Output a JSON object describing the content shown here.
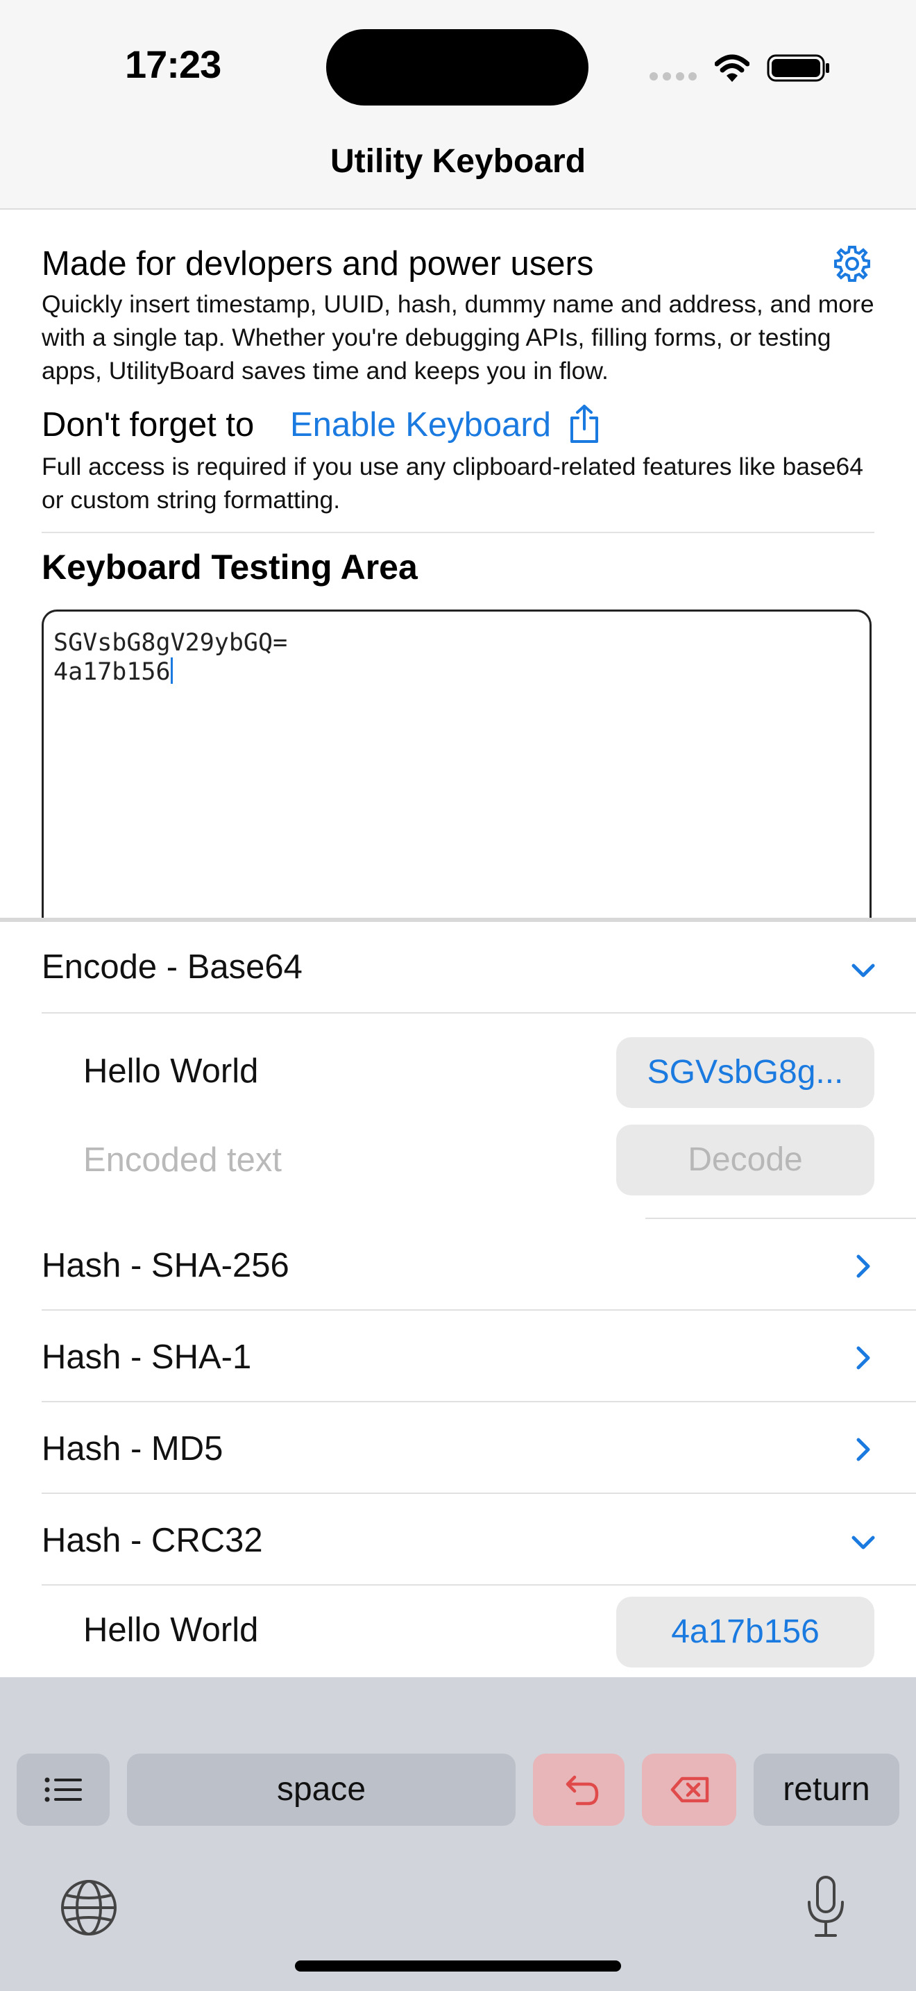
{
  "status_bar": {
    "time": "17:23"
  },
  "nav": {
    "title": "Utility Keyboard"
  },
  "intro": {
    "heading": "Made for devlopers and power users",
    "description": "Quickly insert timestamp, UUID, hash, dummy name and address, and more with a single tap. Whether you're debugging APIs, filling forms, or testing apps, UtilityBoard saves time and keeps you in flow.",
    "reminder_prefix": "Don't forget to",
    "enable_link": "Enable Keyboard",
    "access_note": "Full access is required if you use any clipboard-related features like base64 or custom string formatting."
  },
  "testing": {
    "heading": "Keyboard Testing Area",
    "line1": "SGVsbG8gV29ybGQ=",
    "line2": "4a17b156"
  },
  "panel": {
    "base64": {
      "title": "Encode - Base64",
      "input": "Hello World",
      "output": "SGVsbG8g...",
      "decode_placeholder": "Encoded text",
      "decode_button": "Decode"
    },
    "sha256": {
      "title": "Hash - SHA-256"
    },
    "sha1": {
      "title": "Hash - SHA-1"
    },
    "md5": {
      "title": "Hash - MD5"
    },
    "crc32": {
      "title": "Hash - CRC32",
      "input": "Hello World",
      "output": "4a17b156"
    }
  },
  "keyboard": {
    "space_label": "space",
    "return_label": "return"
  },
  "colors": {
    "accent": "#1a7ae0",
    "destructive_key": "#e8b6b8",
    "keyboard_bg": "#d1d4db"
  },
  "icons": [
    "gear-icon",
    "share-icon",
    "chevron-down-icon",
    "chevron-right-icon",
    "list-icon",
    "undo-icon",
    "delete-icon",
    "globe-icon",
    "microphone-icon",
    "wifi-icon",
    "battery-icon"
  ]
}
